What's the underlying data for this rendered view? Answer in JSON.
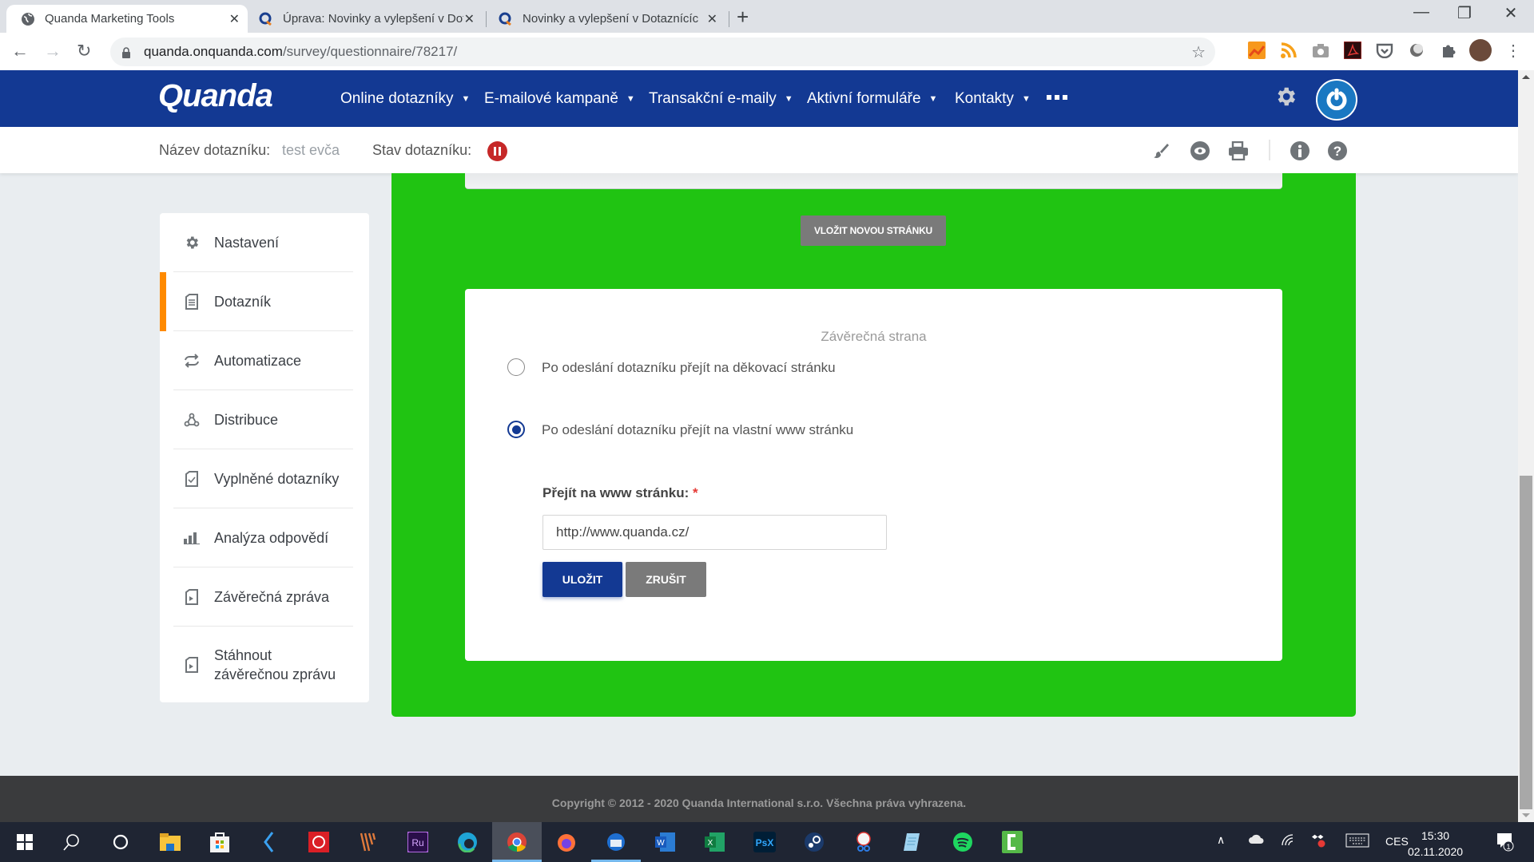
{
  "browser": {
    "tabs": [
      {
        "title": "Quanda Marketing Tools",
        "active": true,
        "icon": "globe-icon"
      },
      {
        "title": "Úprava: Novinky a vylepšení v Dotaz",
        "active": false,
        "icon": "quanda-favicon"
      },
      {
        "title": "Novinky a vylepšení v Dotaznících",
        "active": false,
        "icon": "quanda-favicon"
      }
    ],
    "new_tab": "+",
    "window_controls": {
      "minimize": "—",
      "maximize": "❐",
      "close": "✕"
    },
    "url_domain": "quanda.onquanda.com",
    "url_path": "/survey/questionnaire/78217/",
    "extensions": [
      "analytics-extension-icon",
      "rss-extension-icon",
      "camera-extension-icon",
      "pdf-extension-icon",
      "pocket-extension-icon",
      "circle-extension-icon",
      "puzzle-extensions-icon",
      "profile-avatar",
      "kebab-menu-icon"
    ]
  },
  "header": {
    "logo": "Quanda",
    "menu": [
      {
        "label": "Online dotazníky"
      },
      {
        "label": "E-mailové kampaně"
      },
      {
        "label": "Transakční e-maily"
      },
      {
        "label": "Aktivní formuláře"
      },
      {
        "label": "Kontakty"
      }
    ]
  },
  "subheader": {
    "name_label": "Název dotazníku:",
    "name_value": "test evča",
    "status_label": "Stav dotazníku:",
    "status": "paused",
    "status_color": "#c62828",
    "tools": [
      "brush-icon",
      "eye-icon",
      "print-icon",
      "info-icon",
      "help-icon"
    ]
  },
  "sidebar": {
    "active_index": 1,
    "accent_color": "#ff8a00",
    "items": [
      {
        "label": "Nastavení",
        "icon": "gear-icon"
      },
      {
        "label": "Dotazník",
        "icon": "document-icon"
      },
      {
        "label": "Automatizace",
        "icon": "repeat-icon"
      },
      {
        "label": "Distribuce",
        "icon": "share-icon"
      },
      {
        "label": "Vyplněné dotazníky",
        "icon": "checked-document-icon"
      },
      {
        "label": "Analýza odpovědí",
        "icon": "bar-chart-icon"
      },
      {
        "label": "Závěrečná zpráva",
        "icon": "report-icon"
      },
      {
        "label": "Stáhnout závěrečnou zprávu",
        "icon": "download-report-icon"
      }
    ]
  },
  "main": {
    "background_color": "#20c412",
    "insert_page_button": "VLOŽIT NOVOU STRÁNKU",
    "card": {
      "title": "Závěrečná strana",
      "options": [
        {
          "label": "Po odeslání dotazníku přejít na děkovací stránku",
          "selected": false
        },
        {
          "label": "Po odeslání dotazníku přejít na vlastní www stránku",
          "selected": true
        }
      ],
      "url_label": "Přejít na www stránku:",
      "required_mark": "*",
      "url_value": "http://www.quanda.cz/",
      "save_button": "ULOŽIT",
      "cancel_button": "ZRUŠIT"
    }
  },
  "footer": {
    "copyright": "Copyright © 2012 - 2020 Quanda International s.r.o. Všechna práva vyhrazena."
  },
  "taskbar": {
    "apps": [
      "windows-start",
      "search",
      "cortana",
      "file-explorer",
      "microsoft-store",
      "app-blue-bolt",
      "creative-cloud",
      "app-stripes",
      "adobe-rush",
      "edge",
      "chrome",
      "firefox",
      "thunderbird",
      "word",
      "excel",
      "photoshop-express",
      "steam",
      "snipping-tool",
      "notepad",
      "spotify",
      "camtasia"
    ],
    "active_app": "chrome",
    "tray": {
      "language": "CES",
      "time": "15:30",
      "date": "02.11.2020",
      "notifications": "1"
    }
  }
}
